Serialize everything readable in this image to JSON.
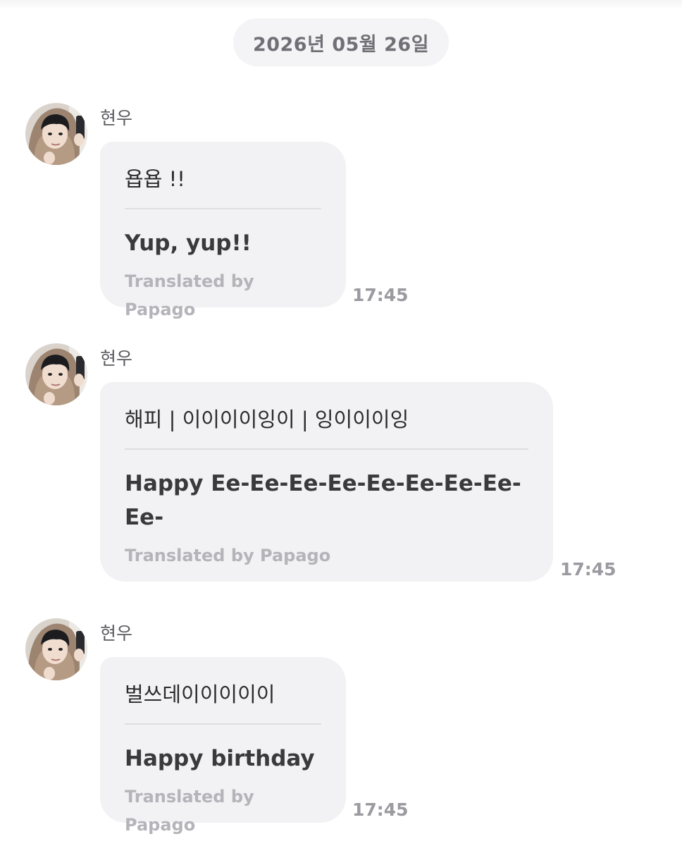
{
  "chat": {
    "date_divider": "2026년 05월 26일",
    "messages": [
      {
        "sender": "현우",
        "original": "욥욥 !!",
        "translation": "Yup, yup!!",
        "credit": "Translated by Papago",
        "time": "17:45"
      },
      {
        "sender": "현우",
        "original": "해피 | 이이이이잉이 | 잉이이이잉",
        "translation": "Happy Ee-Ee-Ee-Ee-Ee-Ee-Ee-Ee-Ee-",
        "credit": "Translated by Papago",
        "time": "17:45"
      },
      {
        "sender": "현우",
        "original": "벌쓰데이이이이이",
        "translation": "Happy birthday",
        "credit": "Translated by Papago",
        "time": "17:45"
      }
    ]
  },
  "icons": {
    "avatar": "profile-photo"
  },
  "colors": {
    "bubble": "#f2f2f4",
    "date_pill": "#f4f4f6",
    "credit_text": "#b4b4ba",
    "time_text": "#9a9aa0"
  }
}
